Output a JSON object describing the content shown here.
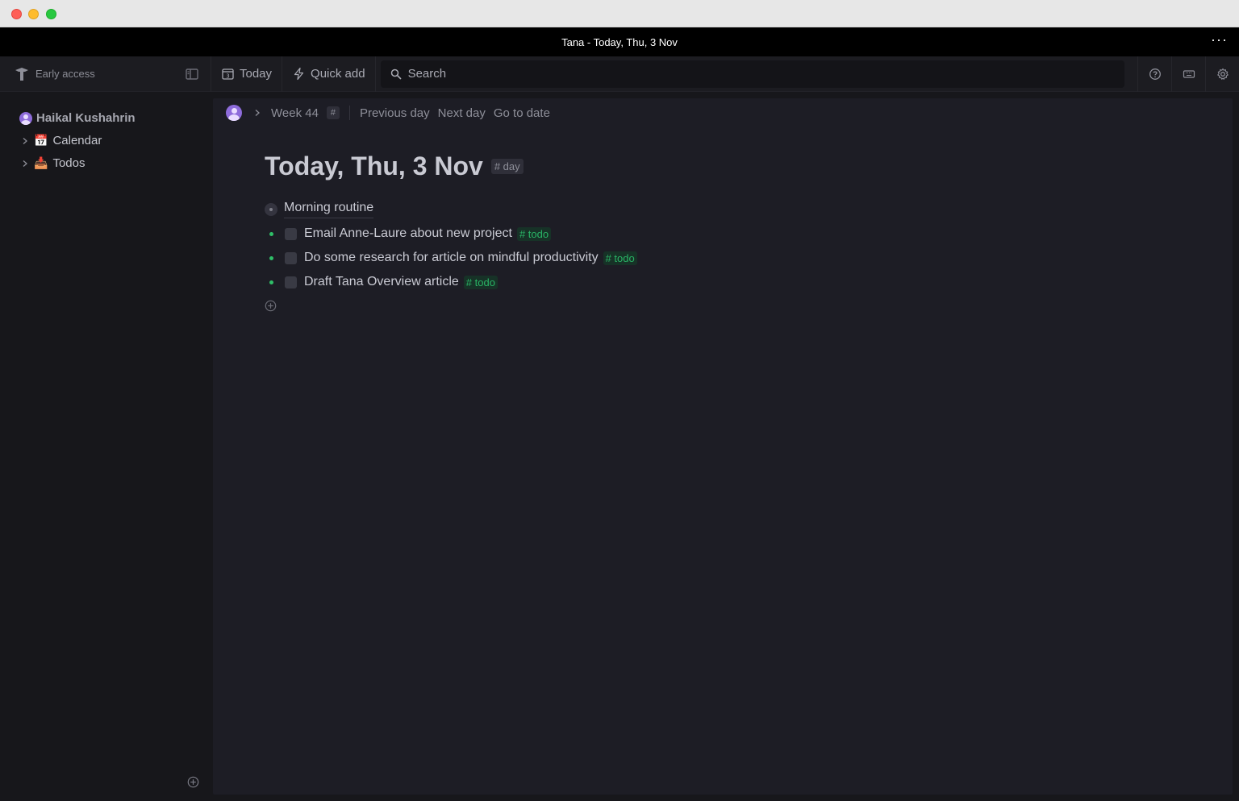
{
  "window": {
    "title": "Tana - Today, Thu, 3 Nov",
    "more_label": "···"
  },
  "toolbar": {
    "early_access": "Early access",
    "today_label": "Today",
    "quick_add_label": "Quick add",
    "search_placeholder": "Search"
  },
  "sidebar": {
    "workspace": "Haikal Kushahrin",
    "items": [
      {
        "emoji": "📅",
        "label": "Calendar"
      },
      {
        "emoji": "📥",
        "label": "Todos"
      }
    ]
  },
  "breadcrumb": {
    "week": "Week 44",
    "hash": "#",
    "previous_day": "Previous day",
    "next_day": "Next day",
    "go_to_date": "Go to date"
  },
  "page": {
    "title": "Today, Thu, 3 Nov",
    "tag": "# day",
    "routine": "Morning routine",
    "todos": [
      {
        "text": "Email Anne-Laure about new project",
        "tag": "# todo"
      },
      {
        "text": "Do some research for article on mindful productivity",
        "tag": "# todo"
      },
      {
        "text": "Draft Tana Overview article",
        "tag": "# todo"
      }
    ]
  },
  "colors": {
    "accent_green": "#2fbf68",
    "avatar_purple": "#8e6cdb",
    "background": "#1d1d25"
  }
}
